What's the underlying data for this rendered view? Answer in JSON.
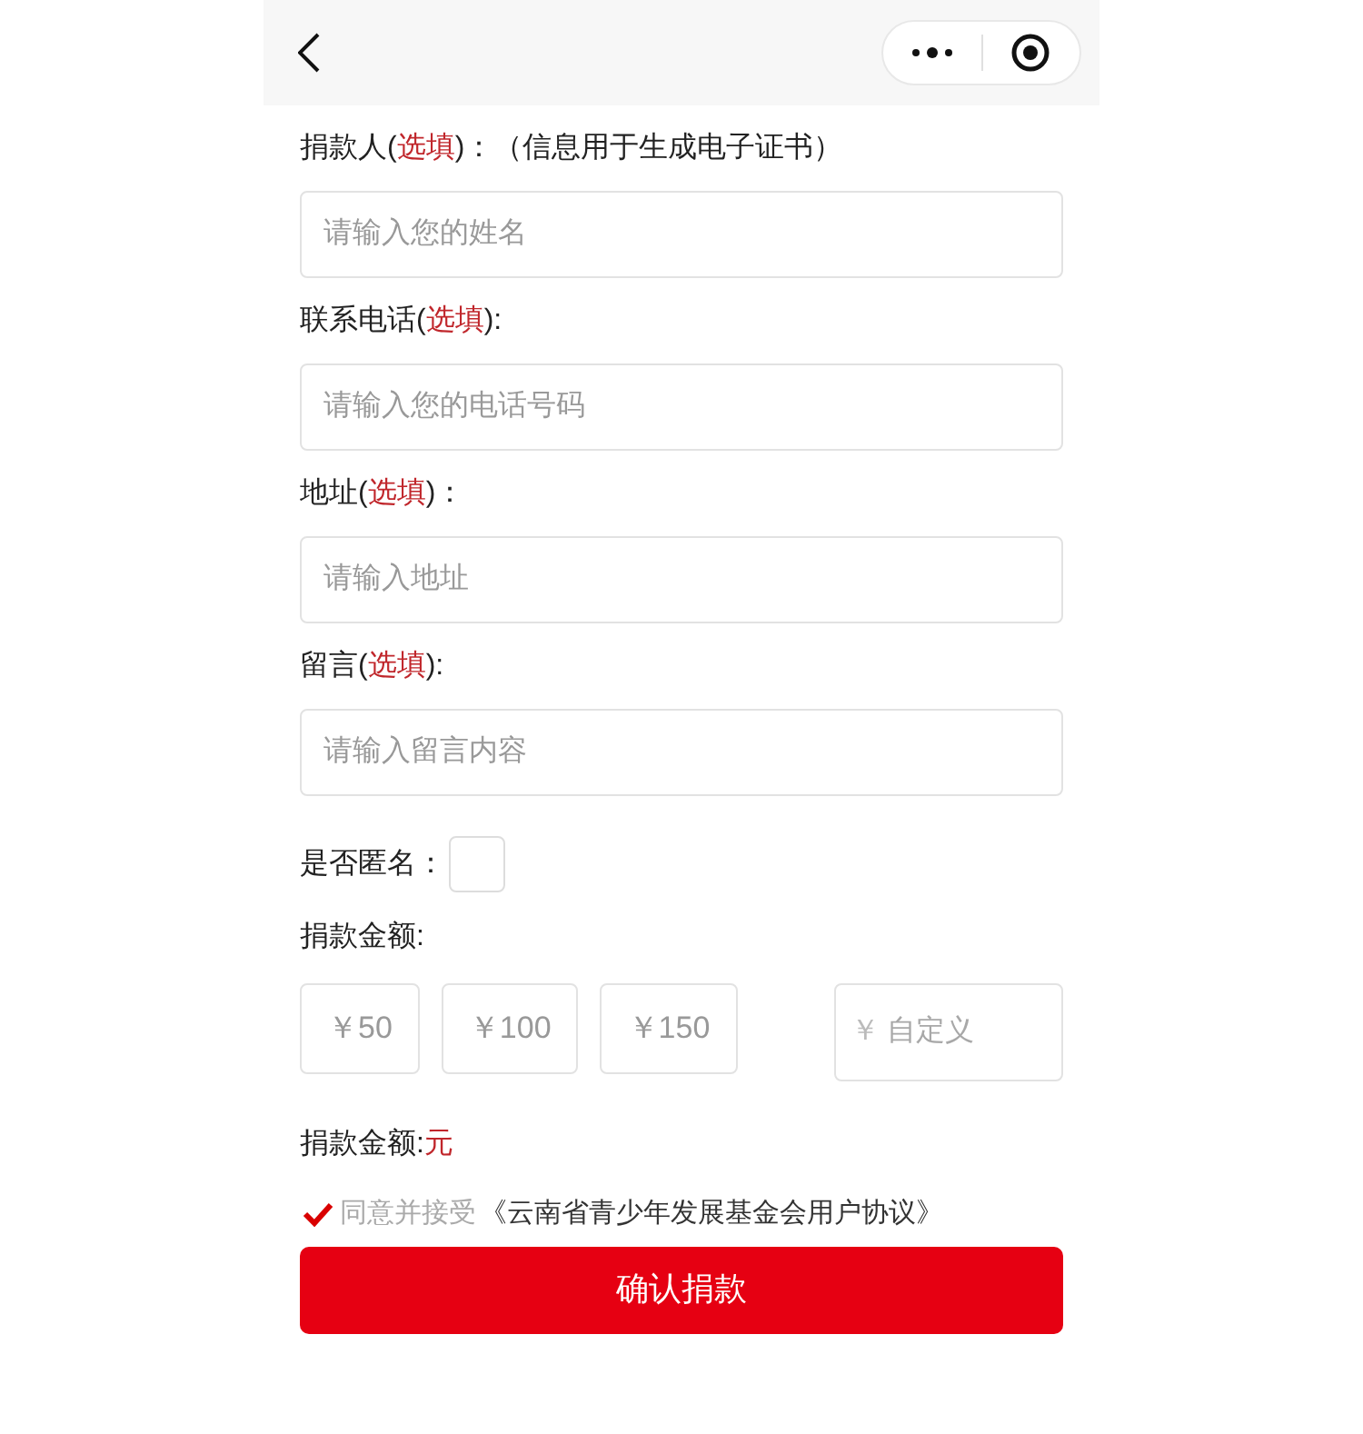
{
  "fields": [
    {
      "label": {
        "before": "捐款人(",
        "optional": "选填",
        "after": ")：（信息用于生成电子证书）"
      },
      "placeholder": "请输入您的姓名"
    },
    {
      "label": {
        "before": "联系电话(",
        "optional": "选填",
        "after": "):"
      },
      "placeholder": "请输入您的电话号码"
    },
    {
      "label": {
        "before": "地址(",
        "optional": "选填",
        "after": ")："
      },
      "placeholder": "请输入地址"
    },
    {
      "label": {
        "before": "留言(",
        "optional": "选填",
        "after": "):"
      },
      "placeholder": "请输入留言内容"
    }
  ],
  "anonymous": {
    "label": "是否匿名：",
    "checked": false
  },
  "amount": {
    "label": "捐款金额:",
    "options": [
      {
        "text": "￥50",
        "selected": false
      },
      {
        "text": "￥100",
        "selected": false
      },
      {
        "text": "￥150",
        "selected": false
      }
    ],
    "custom": {
      "symbol": "￥",
      "placeholder": "自定义"
    }
  },
  "total": {
    "label": "捐款金额:",
    "unit": "元"
  },
  "agreement": {
    "agreed": true,
    "text": "同意并接受",
    "link": "《云南省青少年发展基金会用户协议》"
  },
  "submit": "确认捐款"
}
